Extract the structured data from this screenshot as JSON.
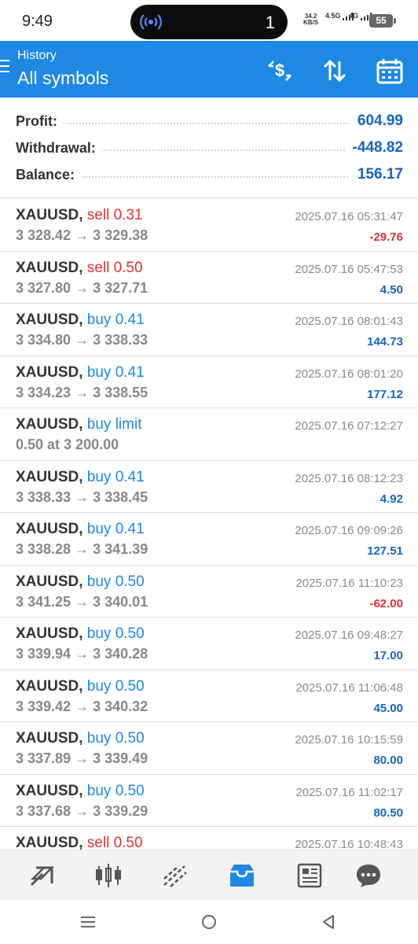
{
  "status_bar": {
    "time": "9:49",
    "notification_count": "1",
    "net_speed": "34.2",
    "net_unit": "KB/S",
    "signal1": "4.5G",
    "signal2": "4G",
    "battery": "55"
  },
  "header": {
    "subtitle": "History",
    "title": "All symbols",
    "icons": [
      "dollar-swap-icon",
      "sort-icon",
      "calendar-icon"
    ]
  },
  "summary": {
    "profit_label": "Profit:",
    "profit_value": "604.99",
    "withdrawal_label": "Withdrawal:",
    "withdrawal_value": "-448.82",
    "balance_label": "Balance:",
    "balance_value": "156.17"
  },
  "trades": [
    {
      "symbol": "XAUUSD,",
      "side": "sell 0.31",
      "side_type": "sell",
      "prices": "3 328.42 → 3 329.38",
      "date": "2025.07.16 05:31:47",
      "pl": "-29.76",
      "pl_type": "neg"
    },
    {
      "symbol": "XAUUSD,",
      "side": "sell 0.50",
      "side_type": "sell",
      "prices": "3 327.80 → 3 327.71",
      "date": "2025.07.16 05:47:53",
      "pl": "4.50",
      "pl_type": "pos"
    },
    {
      "symbol": "XAUUSD,",
      "side": "buy 0.41",
      "side_type": "buy",
      "prices": "3 334.80 → 3 338.33",
      "date": "2025.07.16 08:01:43",
      "pl": "144.73",
      "pl_type": "pos"
    },
    {
      "symbol": "XAUUSD,",
      "side": "buy 0.41",
      "side_type": "buy",
      "prices": "3 334.23 → 3 338.55",
      "date": "2025.07.16 08:01:20",
      "pl": "177.12",
      "pl_type": "pos"
    },
    {
      "symbol": "XAUUSD,",
      "side": "buy limit",
      "side_type": "buy",
      "prices": "0.50 at 3 200.00",
      "date": "2025.07.16 07:12:27",
      "pl": "",
      "pl_type": "pos"
    },
    {
      "symbol": "XAUUSD,",
      "side": "buy 0.41",
      "side_type": "buy",
      "prices": "3 338.33 → 3 338.45",
      "date": "2025.07.16 08:12:23",
      "pl": "4.92",
      "pl_type": "pos"
    },
    {
      "symbol": "XAUUSD,",
      "side": "buy 0.41",
      "side_type": "buy",
      "prices": "3 338.28 → 3 341.39",
      "date": "2025.07.16 09:09:26",
      "pl": "127.51",
      "pl_type": "pos"
    },
    {
      "symbol": "XAUUSD,",
      "side": "buy 0.50",
      "side_type": "buy",
      "prices": "3 341.25 → 3 340.01",
      "date": "2025.07.16 11:10:23",
      "pl": "-62.00",
      "pl_type": "neg"
    },
    {
      "symbol": "XAUUSD,",
      "side": "buy 0.50",
      "side_type": "buy",
      "prices": "3 339.94 → 3 340.28",
      "date": "2025.07.16 09:48:27",
      "pl": "17.00",
      "pl_type": "pos"
    },
    {
      "symbol": "XAUUSD,",
      "side": "buy 0.50",
      "side_type": "buy",
      "prices": "3 339.42 → 3 340.32",
      "date": "2025.07.16 11:06:48",
      "pl": "45.00",
      "pl_type": "pos"
    },
    {
      "symbol": "XAUUSD,",
      "side": "buy 0.50",
      "side_type": "buy",
      "prices": "3 337.89 → 3 339.49",
      "date": "2025.07.16 10:15:59",
      "pl": "80.00",
      "pl_type": "pos"
    },
    {
      "symbol": "XAUUSD,",
      "side": "buy 0.50",
      "side_type": "buy",
      "prices": "3 337.68 → 3 339.29",
      "date": "2025.07.16 11:02:17",
      "pl": "80.50",
      "pl_type": "pos"
    },
    {
      "symbol": "XAUUSD,",
      "side": "sell 0.50",
      "side_type": "sell",
      "prices": "",
      "date": "2025.07.16 10:48:43",
      "pl": "",
      "pl_type": "pos"
    }
  ],
  "bottom_nav": {
    "items": [
      "quotes-icon",
      "chart-icon",
      "trade-icon",
      "history-icon",
      "news-icon",
      "chat-icon"
    ],
    "active": "history-icon",
    "active_color": "#1e88e5"
  },
  "colors": {
    "header": "#1e88e5",
    "sell": "#e03131",
    "buy": "#1e88e5",
    "profit": "#1565c0",
    "loss": "#e03131"
  }
}
